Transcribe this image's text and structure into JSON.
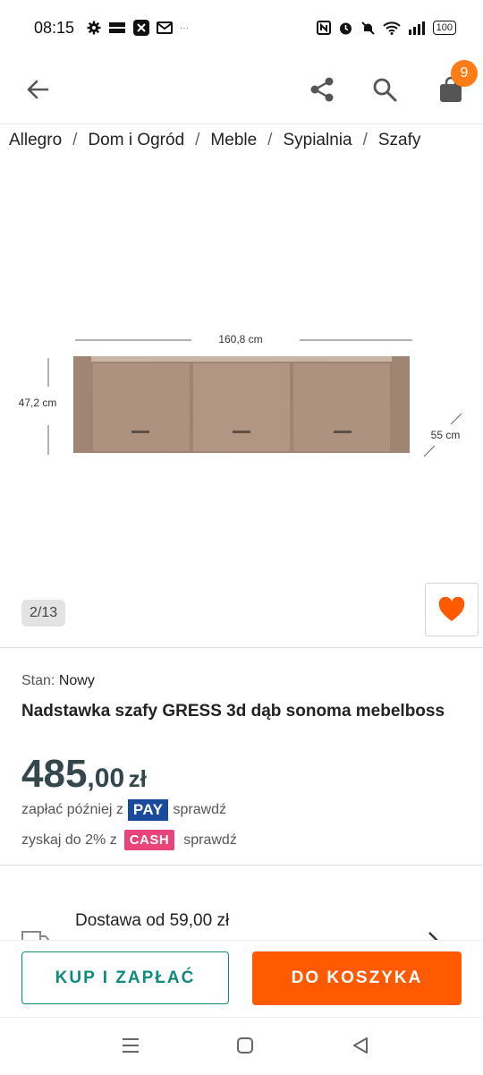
{
  "status_bar": {
    "time": "08:15",
    "battery": "100"
  },
  "header": {
    "cart_count": "9"
  },
  "breadcrumb": [
    "Allegro",
    "Dom i Ogród",
    "Meble",
    "Sypialnia",
    "Szafy"
  ],
  "gallery": {
    "counter": "2/13",
    "dimensions": {
      "width": "160,8 cm",
      "height": "47,2 cm",
      "depth": "55 cm"
    }
  },
  "product": {
    "condition_label": "Stan:",
    "condition_value": "Nowy",
    "title": "Nadstawka szafy GRESS 3d dąb sonoma mebelboss",
    "price_int": "485",
    "price_dec": ",00",
    "currency": "zł",
    "pay_later_text": "zapłać później z",
    "pay_badge": "PAY",
    "check_label": "sprawdź",
    "cash_text": "zyskaj do 2% z",
    "cash_badge": "CASH"
  },
  "delivery": {
    "text": "Dostawa od 59,00 zł"
  },
  "actions": {
    "buy_now": "KUP I ZAPŁAĆ",
    "add_to_cart": "DO KOSZYKA"
  },
  "colors": {
    "accent_orange": "#ff5a00",
    "teal": "#0f8a7d",
    "price": "#33474d",
    "pay_blue": "#1a4a9c",
    "cash_pink": "#e8447a"
  }
}
